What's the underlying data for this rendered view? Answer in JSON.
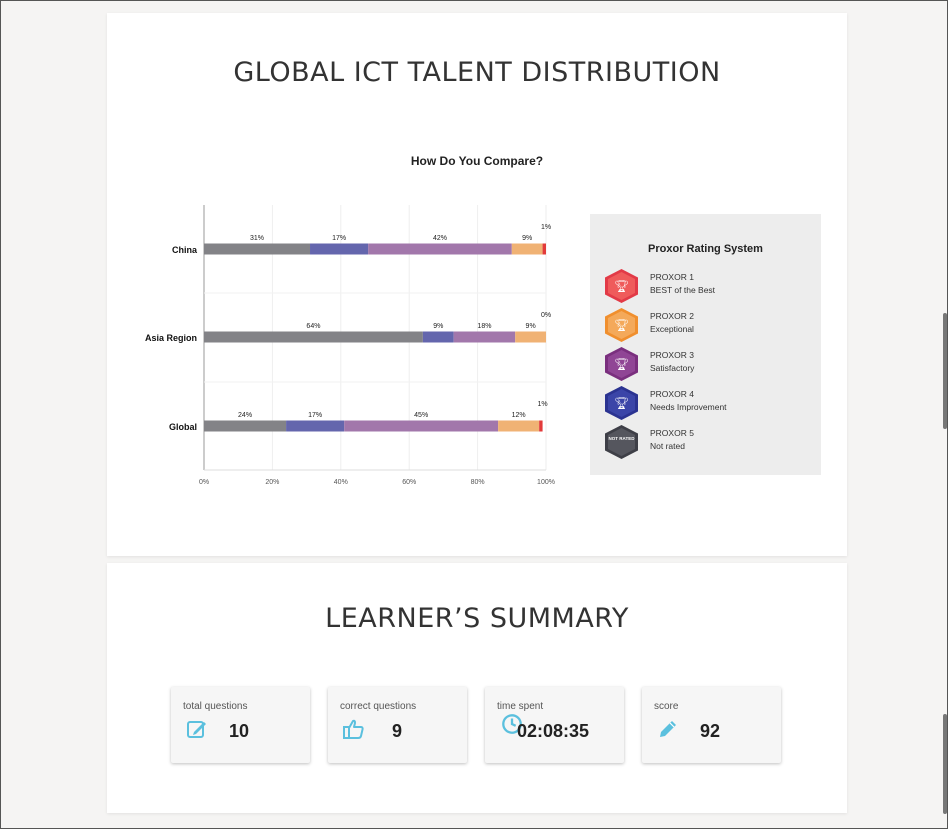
{
  "talent_section": {
    "title": "GLOBAL ICT TALENT DISTRIBUTION"
  },
  "chart_data": {
    "type": "bar",
    "orientation": "horizontal",
    "stacked": true,
    "title": "How Do You Compare?",
    "categories": [
      "China",
      "Asia Region",
      "Global"
    ],
    "segments": [
      {
        "color": "#838387",
        "values": [
          31,
          64,
          24
        ]
      },
      {
        "color": "#6466ad",
        "values": [
          17,
          9,
          17
        ]
      },
      {
        "color": "#a277ab",
        "values": [
          42,
          18,
          45
        ]
      },
      {
        "color": "#f0b274",
        "values": [
          9,
          9,
          12
        ]
      },
      {
        "color": "#e23a3a",
        "values": [
          1,
          0,
          1
        ]
      }
    ],
    "labels": [
      [
        "31%",
        "17%",
        "42%",
        "9%",
        "1%"
      ],
      [
        "64%",
        "9%",
        "18%",
        "9%",
        "0%"
      ],
      [
        "24%",
        "17%",
        "45%",
        "12%",
        "1%"
      ]
    ],
    "xticks": [
      "0%",
      "20%",
      "40%",
      "60%",
      "80%",
      "100%"
    ],
    "xlim": [
      0,
      100
    ],
    "grid": true
  },
  "legend": {
    "title": "Proxor Rating System",
    "items": [
      {
        "name": "PROXOR 1",
        "desc": "BEST of the Best",
        "color": "#e23a47",
        "inner": "#ef5b5b",
        "icon": "trophy-icon"
      },
      {
        "name": "PROXOR 2",
        "desc": "Exceptional",
        "color": "#f08f2e",
        "inner": "#f4a95a",
        "icon": "trophy-icon"
      },
      {
        "name": "PROXOR 3",
        "desc": "Satisfactory",
        "color": "#7a2f7e",
        "inner": "#904595",
        "icon": "trophy-icon"
      },
      {
        "name": "PROXOR 4",
        "desc": "Needs Improvement",
        "color": "#2b3391",
        "inner": "#3b45a8",
        "icon": "trophy-icon"
      },
      {
        "name": "PROXOR 5",
        "desc": "Not rated",
        "color": "#3e3f47",
        "inner": "#55565e",
        "badge_text": "NOT RATED"
      }
    ]
  },
  "summary": {
    "title": "LEARNER’S SUMMARY",
    "stats": [
      {
        "label": "total questions",
        "value": "10",
        "icon": "edit-icon"
      },
      {
        "label": "correct questions",
        "value": "9",
        "icon": "thumbs-up-icon"
      },
      {
        "label": "time spent",
        "value": "02:08:35",
        "icon": "clock-icon"
      },
      {
        "label": "score",
        "value": "92",
        "icon": "pencil-icon"
      }
    ]
  },
  "accent_color": "#5bc0de"
}
